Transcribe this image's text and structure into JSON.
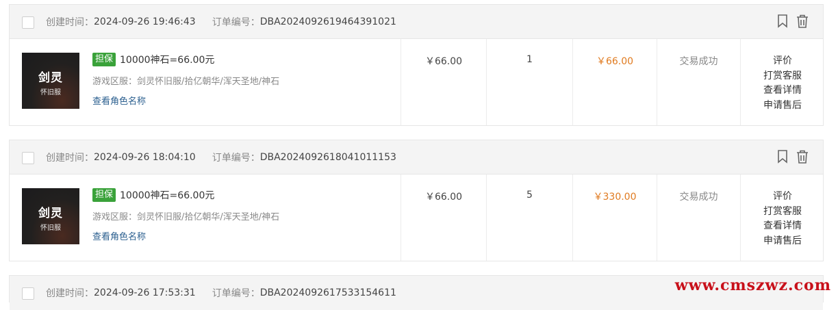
{
  "labels": {
    "created": "创建时间：",
    "order_no": "订单编号：",
    "guarantee": "担保",
    "server_prefix": "游戏区服：",
    "view_role": "查看角色名称"
  },
  "orders": [
    {
      "created": "2024-09-26 19:46:43",
      "order_no": "DBA2024092619464391021",
      "thumb_line1": "剑灵",
      "thumb_line2": "怀旧服",
      "title": "10000神石=66.00元",
      "server": "剑灵怀旧服/拾亿朝华/浑天圣地/神石",
      "price": "￥66.00",
      "qty": "1",
      "total": "￥66.00",
      "status": "交易成功",
      "actions": [
        "评价",
        "打赏客服",
        "查看详情",
        "申请售后"
      ]
    },
    {
      "created": "2024-09-26 18:04:10",
      "order_no": "DBA2024092618041011153",
      "thumb_line1": "剑灵",
      "thumb_line2": "怀旧服",
      "title": "10000神石=66.00元",
      "server": "剑灵怀旧服/拾亿朝华/浑天圣地/神石",
      "price": "￥66.00",
      "qty": "5",
      "total": "￥330.00",
      "status": "交易成功",
      "actions": [
        "评价",
        "打赏客服",
        "查看详情",
        "申请售后"
      ]
    },
    {
      "created": "2024-09-26 17:53:31",
      "order_no": "DBA2024092617533154611"
    }
  ],
  "icons": [
    "bookmark-icon",
    "trash-icon"
  ],
  "colors": {
    "accent_price": "#e07a1f",
    "guarantee_badge": "#3aa23a",
    "link": "#2b5f8f",
    "watermark": "#c8101a"
  },
  "watermark": "www.cmszwz.com"
}
